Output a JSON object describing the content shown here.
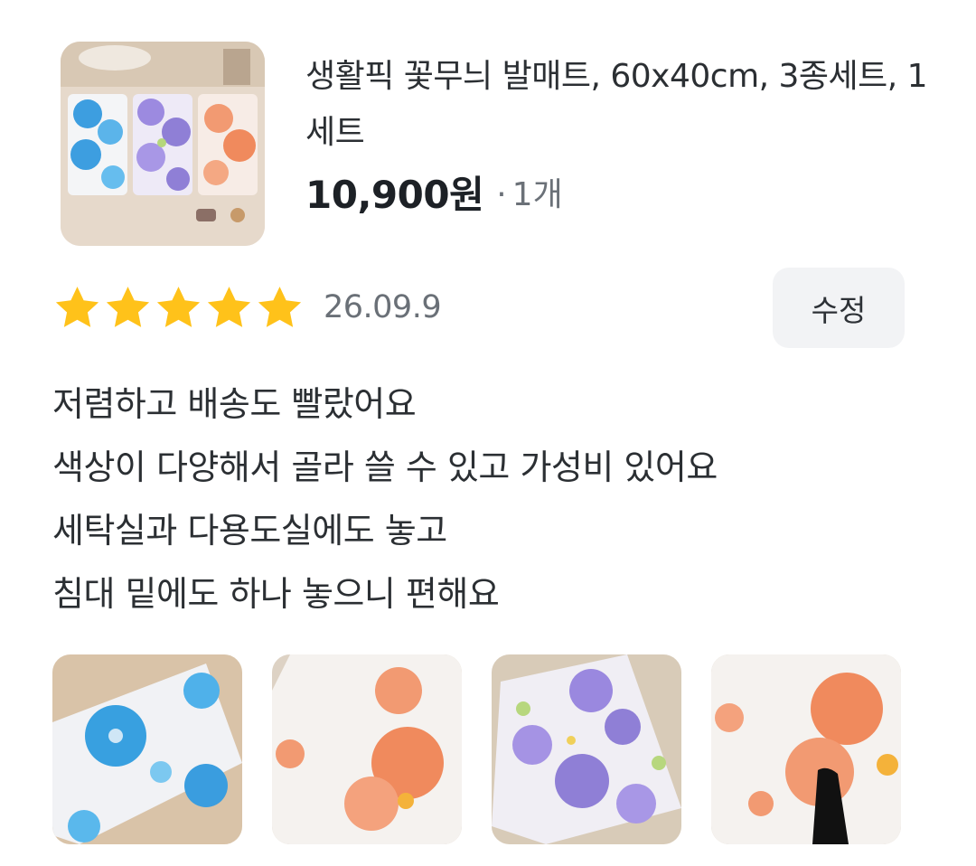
{
  "product": {
    "name": "생활픽 꽃무늬 발매트, 60x40cm, 3종세트, 1세트",
    "price": "10,900원",
    "quantity_separator": "·",
    "quantity": "1개",
    "thumbnail_icon": "product-photo"
  },
  "review": {
    "rating": 5,
    "rating_max": 5,
    "star_color": "#FFC21A",
    "date": "26.09.9",
    "edit_label": "수정",
    "lines": [
      "저렴하고 배송도 빨랐어요",
      "색상이 다양해서 골라 쓸 수 있고 가성비 있어요",
      "세탁실과 다용도실에도 놓고",
      "침대 밑에도 하나 놓으니 편해요"
    ]
  },
  "photos": [
    {
      "alt": "blue-flower-mat-photo",
      "accent": "#3aa3e0"
    },
    {
      "alt": "orange-flower-mat-photo",
      "accent": "#f08a5d"
    },
    {
      "alt": "purple-flower-mat-photo",
      "accent": "#8f7fd6"
    },
    {
      "alt": "orange-flower-mat-closeup-photo",
      "accent": "#f08a5d"
    }
  ]
}
